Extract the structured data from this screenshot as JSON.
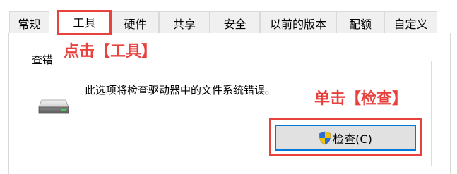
{
  "tabs": [
    {
      "label": "常规",
      "selected": false
    },
    {
      "label": "工具",
      "selected": true
    },
    {
      "label": "硬件",
      "selected": false
    },
    {
      "label": "共享",
      "selected": false
    },
    {
      "label": "安全",
      "selected": false
    },
    {
      "label": "以前的版本",
      "selected": false
    },
    {
      "label": "配额",
      "selected": false
    },
    {
      "label": "自定义",
      "selected": false
    }
  ],
  "check_group": {
    "title": "查错",
    "description": "此选项将检查驱动器中的文件系统错误。",
    "drive_icon": "drive-icon",
    "button_icon": "uac-shield-icon",
    "button_label": "检查(C)"
  },
  "annotations": {
    "step1": "点击【工具】",
    "step2": "单击【检查】",
    "color": "#e8423f"
  },
  "colors": {
    "button_border": "#0078d7",
    "button_bg": "#e1e1e1",
    "tab_bg": "#f0f0f0"
  }
}
